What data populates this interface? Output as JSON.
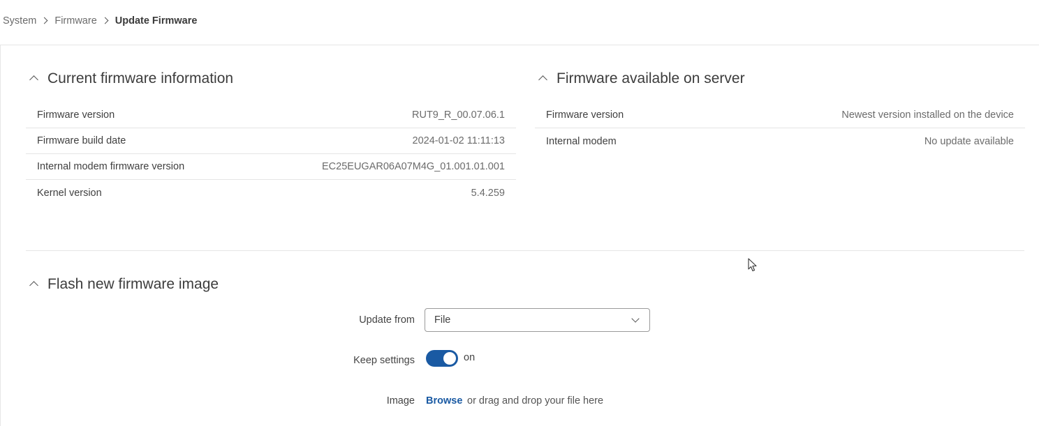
{
  "breadcrumb": {
    "items": [
      "System",
      "Firmware"
    ],
    "current": "Update Firmware"
  },
  "current_firmware": {
    "title": "Current firmware information",
    "rows": [
      {
        "label": "Firmware version",
        "value": "RUT9_R_00.07.06.1"
      },
      {
        "label": "Firmware build date",
        "value": "2024-01-02 11:11:13"
      },
      {
        "label": "Internal modem firmware version",
        "value": "EC25EUGAR06A07M4G_01.001.01.001"
      },
      {
        "label": "Kernel version",
        "value": "5.4.259"
      }
    ]
  },
  "server_firmware": {
    "title": "Firmware available on server",
    "rows": [
      {
        "label": "Firmware version",
        "value": "Newest version installed on the device"
      },
      {
        "label": "Internal modem",
        "value": "No update available"
      }
    ]
  },
  "flash": {
    "title": "Flash new firmware image",
    "update_from_label": "Update from",
    "update_from_value": "File",
    "keep_settings_label": "Keep settings",
    "keep_settings_state": "on",
    "image_label": "Image",
    "browse_label": "Browse",
    "drop_text": "or drag and drop your file here"
  },
  "colors": {
    "accent": "#1a5aa3",
    "text": "#404040",
    "muted": "#6b6b6b",
    "divider": "#e5e5e5"
  },
  "icons": {
    "breadcrumb_separator": "chevron-right-icon",
    "section_collapse": "chevron-up-icon",
    "select_arrow": "chevron-down-icon",
    "pointer": "mouse-cursor-icon"
  }
}
